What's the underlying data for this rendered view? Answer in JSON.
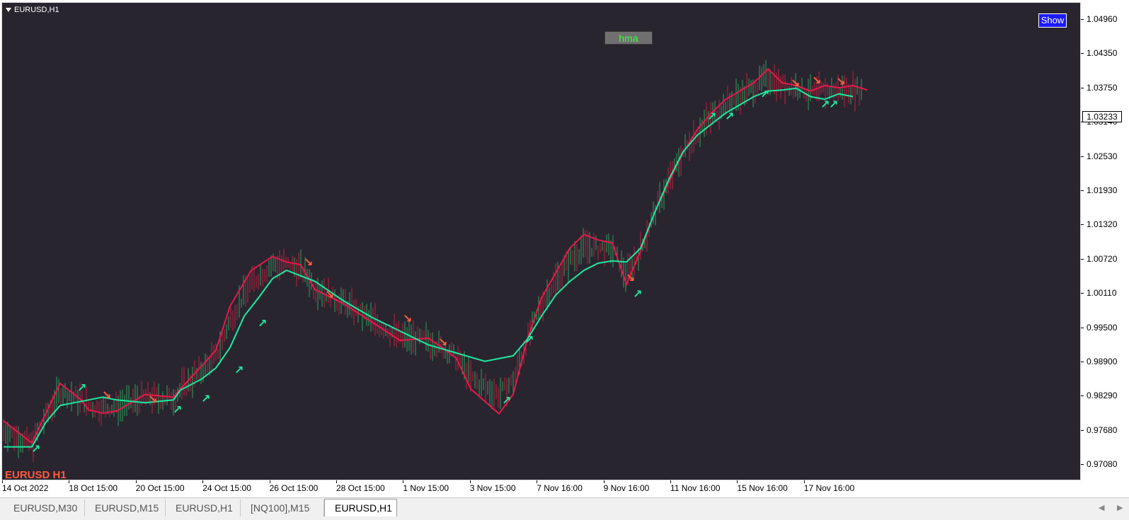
{
  "chart": {
    "symbol_title": "EURUSD,H1",
    "indicator_button": "hma",
    "show_button": "Show",
    "corner_label": "EURUSD H1",
    "current_price": "1.03233",
    "colors": {
      "background": "#29252f",
      "bull": "#1de9a0",
      "bear": "#e8184a",
      "arrow_up": "#1de9a0",
      "arrow_down": "#ff6040",
      "corner_label": "#ff5a3c"
    }
  },
  "price_axis": {
    "labels": [
      "1.04960",
      "1.04350",
      "1.03750",
      "1.03140",
      "1.02530",
      "1.01930",
      "1.01320",
      "1.00720",
      "1.00110",
      "0.99500",
      "0.98900",
      "0.98290",
      "0.97680",
      "0.97080"
    ]
  },
  "time_axis": {
    "labels": [
      "14 Oct 2022",
      "18 Oct 15:00",
      "20 Oct 15:00",
      "24 Oct 15:00",
      "26 Oct 15:00",
      "28 Oct 15:00",
      "1 Nov 15:00",
      "3 Nov 15:00",
      "7 Nov 16:00",
      "9 Nov 16:00",
      "11 Nov 16:00",
      "15 Nov 16:00",
      "17 Nov 16:00"
    ]
  },
  "tabs": [
    {
      "label": "EURUSD,M30",
      "active": false
    },
    {
      "label": "EURUSD,M15",
      "active": false
    },
    {
      "label": "EURUSD,H1",
      "active": false
    },
    {
      "label": "[NQ100],M15",
      "active": false
    },
    {
      "label": "EURUSD,H1",
      "active": true
    }
  ],
  "chart_data": {
    "type": "line",
    "title": "",
    "series": [
      {
        "color": "#e8184a",
        "x": [
          0,
          40,
          80,
          110,
          120,
          140,
          160,
          200,
          240,
          250,
          280,
          300,
          320,
          350,
          380,
          400,
          420,
          440,
          480,
          510,
          540,
          560,
          580,
          600,
          620,
          640,
          660,
          700,
          720,
          740,
          760,
          780,
          800,
          820,
          840,
          860,
          880,
          900,
          920,
          940,
          960,
          980,
          1000,
          1020,
          1040,
          1060,
          1080,
          1100,
          1120,
          1140,
          1160,
          1180,
          1200,
          1220
        ],
        "values": [
          0.9772,
          0.9732,
          0.984,
          0.981,
          0.9792,
          0.9786,
          0.979,
          0.982,
          0.9815,
          0.983,
          0.9872,
          0.99,
          0.998,
          1.0045,
          1.007,
          1.006,
          1.0055,
          1.001,
          0.9985,
          0.996,
          0.9935,
          0.9918,
          0.992,
          0.9922,
          0.9905,
          0.9885,
          0.983,
          0.9785,
          0.982,
          0.992,
          0.9995,
          1.004,
          1.0085,
          1.011,
          1.01,
          1.0095,
          1.002,
          1.008,
          1.015,
          1.0205,
          1.0258,
          1.03,
          1.033,
          1.0355,
          1.037,
          1.0385,
          1.041,
          1.0385,
          1.038,
          1.037,
          1.038,
          1.0376,
          1.038,
          1.0372
        ]
      },
      {
        "color": "#1de9a0",
        "x": [
          0,
          40,
          60,
          80,
          100,
          140,
          160,
          200,
          240,
          250,
          280,
          300,
          320,
          340,
          360,
          380,
          400,
          440,
          480,
          520,
          560,
          600,
          640,
          680,
          720,
          740,
          760,
          780,
          800,
          820,
          840,
          860,
          880,
          900,
          920,
          940,
          960,
          980,
          1000,
          1020,
          1040,
          1060,
          1080,
          1100,
          1120,
          1140,
          1160,
          1180,
          1200
        ],
        "values": [
          0.9725,
          0.9725,
          0.977,
          0.98,
          0.9805,
          0.9815,
          0.981,
          0.9805,
          0.981,
          0.9828,
          0.9848,
          0.9868,
          0.9905,
          0.9962,
          0.9995,
          1.003,
          1.0045,
          1.0025,
          0.999,
          0.996,
          0.9935,
          0.991,
          0.9895,
          0.988,
          0.989,
          0.992,
          0.9962,
          1.0,
          1.0025,
          1.0045,
          1.0058,
          1.0062,
          1.006,
          1.0085,
          1.015,
          1.021,
          1.026,
          1.029,
          1.031,
          1.033,
          1.0345,
          1.036,
          1.037,
          1.0372,
          1.0375,
          1.036,
          1.0355,
          1.0365,
          1.036
        ]
      }
    ],
    "ylim": [
      0.9668,
      1.053
    ],
    "xlabel": "",
    "ylabel": ""
  }
}
